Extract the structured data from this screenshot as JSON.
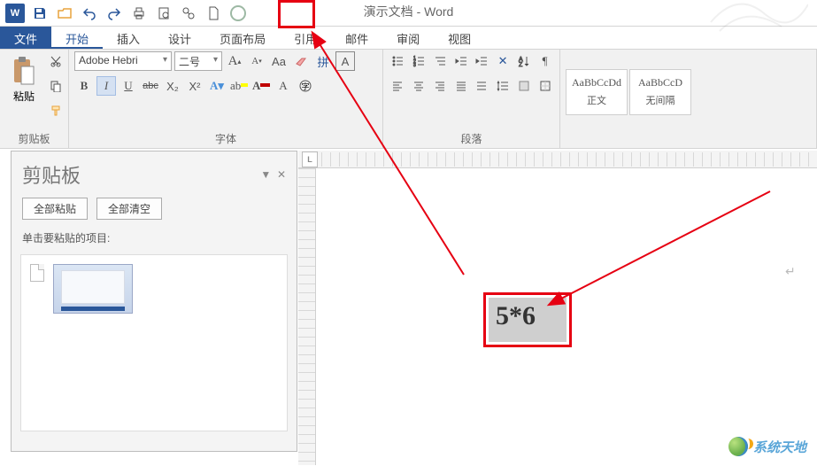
{
  "app": {
    "doc_title": "演示文档 - Word",
    "word_mark": "W"
  },
  "qat": {
    "circle_tool": "○"
  },
  "tabs": {
    "file": "文件",
    "home": "开始",
    "insert": "插入",
    "design": "设计",
    "layout": "页面布局",
    "references": "引用",
    "mailings": "邮件",
    "review": "审阅",
    "view": "视图"
  },
  "ribbon": {
    "clipboard": {
      "label": "剪贴板",
      "paste": "粘贴"
    },
    "font": {
      "label": "字体",
      "family": "Adobe Hebri",
      "size": "二号",
      "bold": "B",
      "italic": "I",
      "underline": "U",
      "strike": "abc",
      "sub": "X₂",
      "sup": "X²",
      "grow": "A",
      "shrink": "A",
      "change_case": "Aa",
      "phonetic": "拼",
      "char_border": "A"
    },
    "paragraph": {
      "label": "段落"
    },
    "styles": {
      "normal_preview": "AaBbCcDd",
      "normal_label": "正文",
      "nospace_preview": "AaBbCcD",
      "nospace_label": "无间隔"
    }
  },
  "clip_pane": {
    "title": "剪贴板",
    "paste_all": "全部粘贴",
    "clear_all": "全部清空",
    "hint": "单击要粘贴的项目:"
  },
  "ruler": {
    "tab_stop": "L"
  },
  "doc": {
    "selected_text": "5*6",
    "return": "↵"
  },
  "watermark": {
    "text": "系统天地"
  }
}
